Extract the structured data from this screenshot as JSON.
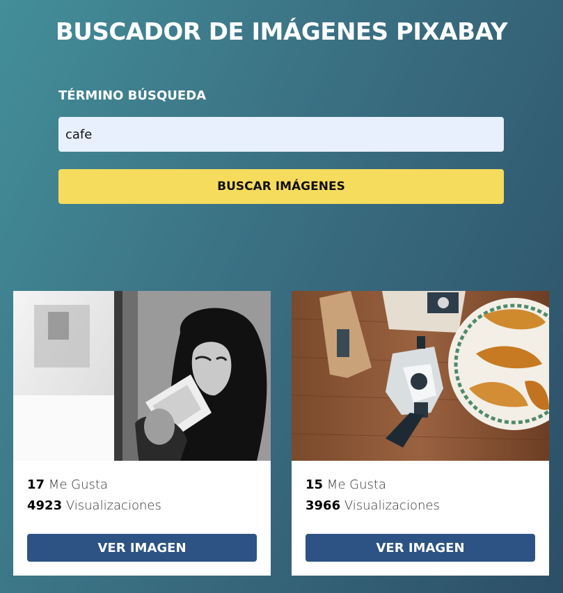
{
  "header": {
    "title": "BUSCADOR DE IMÁGENES PIXABAY"
  },
  "search": {
    "label": "TÉRMINO BÚSQUEDA",
    "value": "cafe",
    "button_label": "BUSCAR IMÁGENES"
  },
  "results": [
    {
      "likes": "17",
      "likes_label": "Me Gusta",
      "views": "4923",
      "views_label": "Visualizaciones",
      "button_label": "VER IMAGEN",
      "image_icon": "woman-drinking-coffee-photo"
    },
    {
      "likes": "15",
      "likes_label": "Me Gusta",
      "views": "3966",
      "views_label": "Visualizaciones",
      "button_label": "VER IMAGEN",
      "image_icon": "moka-pot-croissants-photo"
    }
  ],
  "colors": {
    "accent_yellow": "#f6dc5d",
    "button_blue": "#2d5384",
    "input_bg": "#e8f0fe"
  }
}
